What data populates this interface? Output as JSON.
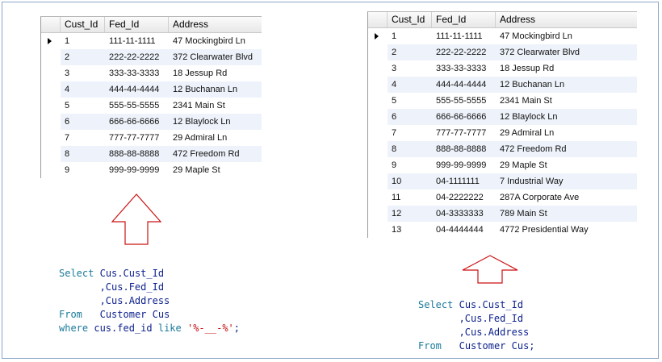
{
  "left_grid": {
    "columns": [
      "Cust_Id",
      "Fed_Id",
      "Address"
    ],
    "rows": [
      [
        "1",
        "111-11-1111",
        "47 Mockingbird Ln"
      ],
      [
        "2",
        "222-22-2222",
        "372 Clearwater Blvd"
      ],
      [
        "3",
        "333-33-3333",
        "18 Jessup Rd"
      ],
      [
        "4",
        "444-44-4444",
        "12 Buchanan Ln"
      ],
      [
        "5",
        "555-55-5555",
        "2341 Main St"
      ],
      [
        "6",
        "666-66-6666",
        "12 Blaylock Ln"
      ],
      [
        "7",
        "777-77-7777",
        "29 Admiral Ln"
      ],
      [
        "8",
        "888-88-8888",
        "472 Freedom Rd"
      ],
      [
        "9",
        "999-99-9999",
        "29 Maple St"
      ]
    ]
  },
  "right_grid": {
    "columns": [
      "Cust_Id",
      "Fed_Id",
      "Address"
    ],
    "rows": [
      [
        "1",
        "111-11-1111",
        "47 Mockingbird Ln"
      ],
      [
        "2",
        "222-22-2222",
        "372 Clearwater Blvd"
      ],
      [
        "3",
        "333-33-3333",
        "18 Jessup Rd"
      ],
      [
        "4",
        "444-44-4444",
        "12 Buchanan Ln"
      ],
      [
        "5",
        "555-55-5555",
        "2341 Main St"
      ],
      [
        "6",
        "666-66-6666",
        "12 Blaylock Ln"
      ],
      [
        "7",
        "777-77-7777",
        "29 Admiral Ln"
      ],
      [
        "8",
        "888-88-8888",
        "472 Freedom Rd"
      ],
      [
        "9",
        "999-99-9999",
        "29 Maple St"
      ],
      [
        "10",
        "04-1111111",
        "7 Industrial Way"
      ],
      [
        "11",
        "04-2222222",
        "287A Corporate Ave"
      ],
      [
        "12",
        "04-3333333",
        "789 Main St"
      ],
      [
        "13",
        "04-4444444",
        "4772 Presidential Way"
      ]
    ]
  },
  "left_query": {
    "line1_kw": "Select",
    "line1_ident": "Cus.Cust_Id",
    "line2_ident": ",Cus.Fed_Id",
    "line3_ident": ",Cus.Address",
    "line4_kw": "From",
    "line4_ident": "Customer Cus",
    "line5_kw": "where",
    "line5_ident": "cus.fed_id",
    "line5_kw2": "like",
    "line5_str": "'%-__-%'",
    "line5_end": ";"
  },
  "right_query": {
    "line1_kw": "Select",
    "line1_ident": "Cus.Cust_Id",
    "line2_ident": ",Cus.Fed_Id",
    "line3_ident": ",Cus.Address",
    "line4_kw": "From",
    "line4_ident": "Customer Cus;"
  },
  "colors": {
    "keyword": "#1a7a9a",
    "identifier": "#0b1f8c",
    "string": "#c41010",
    "arrow": "#cc1111",
    "alt_row": "#eef3fb"
  },
  "icons": {
    "current_row": "row-pointer-icon",
    "up_arrow": "up-arrow-icon"
  }
}
